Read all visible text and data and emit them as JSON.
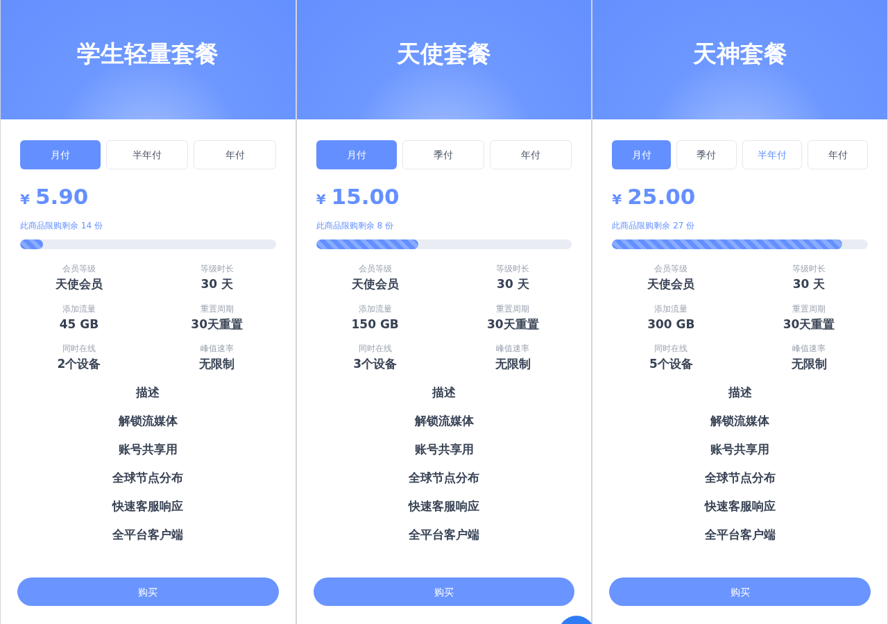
{
  "plans": [
    {
      "title": "学生轻量套餐",
      "periods": [
        {
          "label": "月付",
          "selected": true,
          "hovered": false
        },
        {
          "label": "半年付",
          "selected": false,
          "hovered": false
        },
        {
          "label": "年付",
          "selected": false,
          "hovered": false
        }
      ],
      "currency": "¥",
      "price": "5.90",
      "stock_note": "此商品限购剩余 14 份",
      "level": 0.09,
      "stats": [
        {
          "label": "会员等级",
          "value": "天使会员"
        },
        {
          "label": "等级时长",
          "value": "30 天"
        },
        {
          "label": "添加流量",
          "value": "45 GB"
        },
        {
          "label": "重置周期",
          "value": "30天重置"
        },
        {
          "label": "同时在线",
          "value": "2个设备"
        },
        {
          "label": "峰值速率",
          "value": "无限制"
        }
      ],
      "features": [
        "描述",
        "解锁流媒体",
        "账号共享用",
        "全球节点分布",
        "快速客服响应",
        "全平台客户端"
      ],
      "buy_button": "购买"
    },
    {
      "title": "天使套餐",
      "periods": [
        {
          "label": "月付",
          "selected": true,
          "hovered": false
        },
        {
          "label": "季付",
          "selected": false,
          "hovered": false
        },
        {
          "label": "年付",
          "selected": false,
          "hovered": false
        }
      ],
      "currency": "¥",
      "price": "15.00",
      "stock_note": "此商品限购剩余 8 份",
      "level": 0.4,
      "stats": [
        {
          "label": "会员等级",
          "value": "天使会员"
        },
        {
          "label": "等级时长",
          "value": "30 天"
        },
        {
          "label": "添加流量",
          "value": "150 GB"
        },
        {
          "label": "重置周期",
          "value": "30天重置"
        },
        {
          "label": "同时在线",
          "value": "3个设备"
        },
        {
          "label": "峰值速率",
          "value": "无限制"
        }
      ],
      "features": [
        "描述",
        "解锁流媒体",
        "账号共享用",
        "全球节点分布",
        "快速客服响应",
        "全平台客户端"
      ],
      "buy_button": "购买"
    },
    {
      "title": "天神套餐",
      "periods": [
        {
          "label": "月付",
          "selected": true,
          "hovered": false
        },
        {
          "label": "季付",
          "selected": false,
          "hovered": false
        },
        {
          "label": "半年付",
          "selected": false,
          "hovered": true
        },
        {
          "label": "年付",
          "selected": false,
          "hovered": false
        }
      ],
      "currency": "¥",
      "price": "25.00",
      "stock_note": "此商品限购剩余 27 份",
      "level": 0.9,
      "stats": [
        {
          "label": "会员等级",
          "value": "天使会员"
        },
        {
          "label": "等级时长",
          "value": "30 天"
        },
        {
          "label": "添加流量",
          "value": "300 GB"
        },
        {
          "label": "重置周期",
          "value": "30天重置"
        },
        {
          "label": "同时在线",
          "value": "5个设备"
        },
        {
          "label": "峰值速率",
          "value": "无限制"
        }
      ],
      "features": [
        "描述",
        "解锁流媒体",
        "账号共享用",
        "全球节点分布",
        "快速客服响应",
        "全平台客户端"
      ],
      "buy_button": "购买"
    }
  ]
}
